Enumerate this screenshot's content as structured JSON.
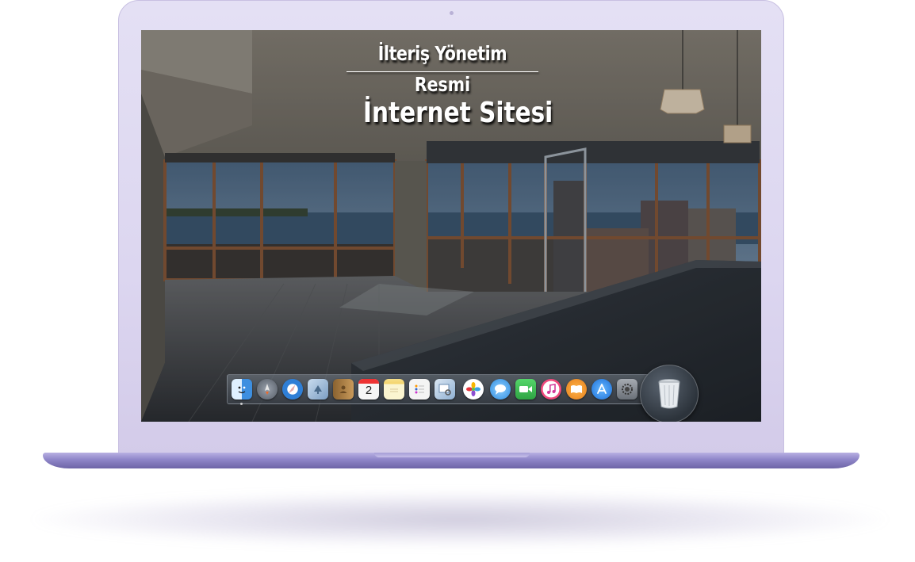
{
  "site": {
    "title_line1": "İlteriş Yönetim",
    "title_line2": "Resmi",
    "title_line3": "İnternet Sitesi"
  },
  "dock": {
    "items": [
      {
        "name": "finder-icon",
        "color": "#3d8fe0"
      },
      {
        "name": "launchpad-icon",
        "color": "#7a8190"
      },
      {
        "name": "safari-icon",
        "color": "#2f7fd6"
      },
      {
        "name": "mail-icon",
        "color": "#8aa6c7"
      },
      {
        "name": "contacts-icon",
        "color": "#b98c4e"
      },
      {
        "name": "calendar-icon",
        "color": "#f2f2f2",
        "label": "2"
      },
      {
        "name": "notes-icon",
        "color": "#f3d36a"
      },
      {
        "name": "reminders-icon",
        "color": "#f0f0f0"
      },
      {
        "name": "preview-icon",
        "color": "#9bb7d4"
      },
      {
        "name": "photos-icon",
        "color": "#ffffff"
      },
      {
        "name": "messages-icon",
        "color": "#3aa3f2"
      },
      {
        "name": "facetime-icon",
        "color": "#3cba54"
      },
      {
        "name": "itunes-icon",
        "color": "#f04a7d"
      },
      {
        "name": "ibooks-icon",
        "color": "#f29a2e"
      },
      {
        "name": "app-store-icon",
        "color": "#2d8cf0"
      },
      {
        "name": "system-preferences-icon",
        "color": "#8a8f96"
      }
    ],
    "trash": {
      "name": "trash-icon"
    }
  },
  "colors": {
    "lid": "#dcd6f0",
    "base": "#8e85c8"
  }
}
